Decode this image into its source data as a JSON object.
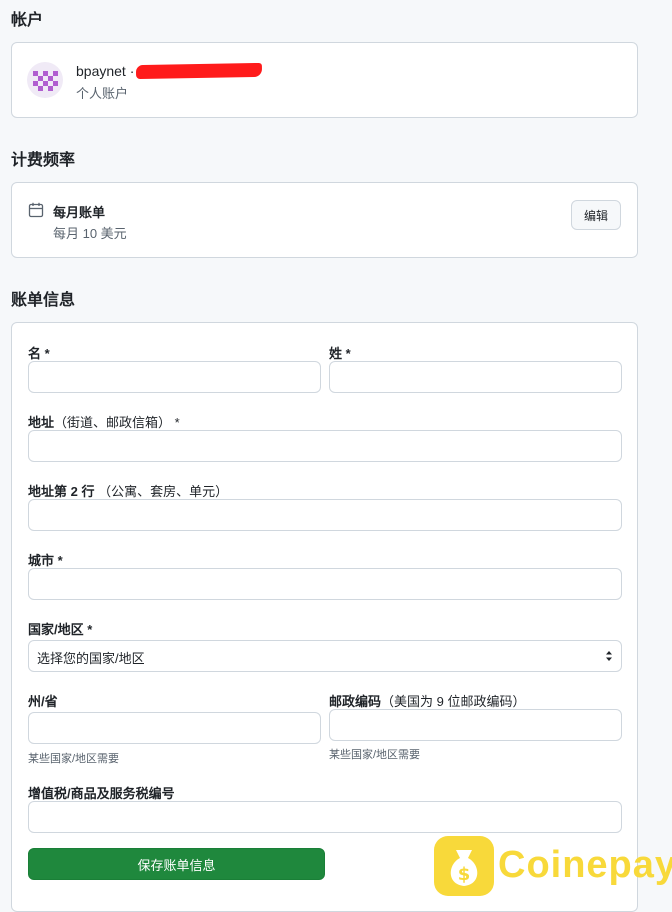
{
  "account": {
    "section_title": "帐户",
    "name": "bpaynet ·",
    "type": "个人账户"
  },
  "billing_frequency": {
    "section_title": "计费频率",
    "plan": "每月账单",
    "price": "每月 10 美元",
    "edit_label": "编辑"
  },
  "billing_info": {
    "section_title": "账单信息",
    "first_name_label": "名 *",
    "last_name_label": "姓 *",
    "address1_label": "地址",
    "address1_sub": "（街道、邮政信箱） *",
    "address2_label": "地址第 2 行",
    "address2_sub": " （公寓、套房、单元）",
    "city_label": "城市 *",
    "country_label": "国家/地区 *",
    "country_value": "选择您的国家/地区",
    "state_label": "州/省",
    "state_hint": "某些国家/地区需要",
    "zip_label": "邮政编码",
    "zip_sub": "（美国为 9 位邮政编码）",
    "zip_hint": "某些国家/地区需要",
    "vat_label": "增值税/商品及服务税编号",
    "save_label": "保存账单信息"
  },
  "watermark": {
    "text": "Coinepay",
    "color": "#f8d93a"
  },
  "colors": {
    "primary_button": "#1f883d",
    "redaction": "#ff1b1b"
  }
}
